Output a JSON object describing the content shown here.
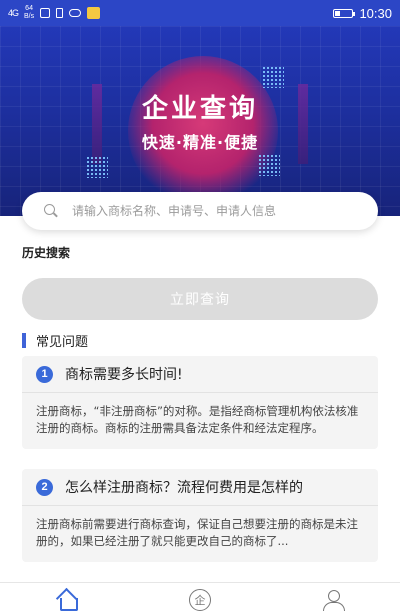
{
  "status_bar": {
    "signal": "4G",
    "net_speed_value": "64",
    "net_speed_unit": "B/s",
    "time": "10:30",
    "battery_level": 0.3
  },
  "banner": {
    "title": "企业查询",
    "subtitle": "快速·精准·便捷"
  },
  "search": {
    "placeholder": "请输入商标名称、申请号、申请人信息",
    "value": ""
  },
  "history": {
    "title": "历史搜索"
  },
  "query_button": {
    "label": "立即查询"
  },
  "faq": {
    "title": "常见问题",
    "items": [
      {
        "number": "1",
        "question": "商标需要多长时间!",
        "answer": "注册商标，“非注册商标”的对称。是指经商标管理机构依法核准注册的商标。商标的注册需具备法定条件和经法定程序。"
      },
      {
        "number": "2",
        "question": "怎么样注册商标？流程何费用是怎样的",
        "answer": "注册商标前需要进行商标查询，保证自己想要注册的商标是未注册的，如果已经注册了就只能更改自己的商标了..."
      }
    ]
  },
  "tab_bar": {
    "company_glyph": "企",
    "active_color": "#3a6ad9",
    "inactive_color": "#777777"
  }
}
